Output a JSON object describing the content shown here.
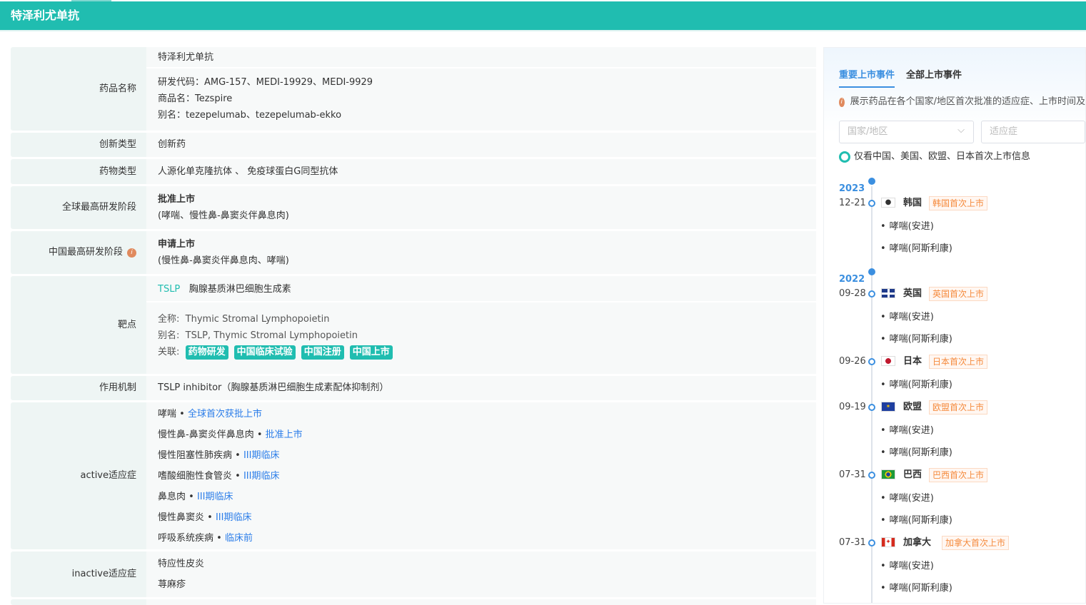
{
  "header": {
    "title": "特泽利尤单抗"
  },
  "rows": {
    "name": {
      "label": "药品名称",
      "value": "特泽利尤单抗",
      "code": "研发代码：AMG-157、MEDI-19929、MEDI-9929",
      "trade": "商品名：Tezspire",
      "alias": "别名：tezepelumab、tezepelumab-ekko"
    },
    "innov": {
      "label": "创新类型",
      "value": "创新药"
    },
    "type": {
      "label": "药物类型",
      "value": "人源化单克隆抗体 、 免疫球蛋白G同型抗体"
    },
    "global": {
      "label": "全球最高研发阶段",
      "stage": "批准上市",
      "detail": "(哮喘、慢性鼻-鼻窦炎伴鼻息肉)"
    },
    "china": {
      "label": "中国最高研发阶段",
      "stage": "申请上市",
      "detail": "(慢性鼻-鼻窦炎伴鼻息肉、哮喘)"
    },
    "target": {
      "label": "靶点",
      "code": "TSLP",
      "name": "胸腺基质淋巴细胞生成素",
      "full_label": "全称:",
      "full": "Thymic Stromal Lymphopoietin",
      "alias_label": "别名:",
      "alias": "TSLP, Thymic Stromal Lymphopoietin",
      "rel_label": "关联:",
      "tags": [
        "药物研发",
        "中国临床试验",
        "中国注册",
        "中国上市"
      ]
    },
    "mech": {
      "label": "作用机制",
      "value": "TSLP inhibitor（胸腺基质淋巴细胞生成素配体抑制剂）"
    },
    "active": {
      "label": "active适应症",
      "items": [
        {
          "name": "哮喘",
          "stage": "全球首次获批上市"
        },
        {
          "name": "慢性鼻-鼻窦炎伴鼻息肉",
          "stage": "批准上市"
        },
        {
          "name": "慢性阻塞性肺疾病",
          "stage": "III期临床"
        },
        {
          "name": "嗜酸细胞性食管炎",
          "stage": "III期临床"
        },
        {
          "name": "鼻息肉",
          "stage": "III期临床"
        },
        {
          "name": "慢性鼻窦炎",
          "stage": "III期临床"
        },
        {
          "name": "呼吸系统疾病",
          "stage": "临床前"
        }
      ]
    },
    "inactive": {
      "label": "inactive适应症",
      "items": [
        "特应性皮炎",
        "荨麻疹"
      ]
    }
  },
  "panel": {
    "tabs": [
      "重要上市事件",
      "全部上市事件"
    ],
    "note": "展示药品在各个国家/地区首次批准的适应症、上市时间及",
    "country_placeholder": "国家/地区",
    "indication_placeholder": "适应症",
    "only_label": "仅看中国、美国、欧盟、日本首次上市信息",
    "timeline": [
      {
        "year": "2023",
        "events": [
          {
            "date": "12-21",
            "flag": "kr",
            "country": "韩国",
            "badge": "韩国首次上市",
            "inds": [
              "哮喘(安进)",
              "哮喘(阿斯利康)"
            ]
          }
        ]
      },
      {
        "year": "2022",
        "events": [
          {
            "date": "09-28",
            "flag": "gb",
            "country": "英国",
            "badge": "英国首次上市",
            "inds": [
              "哮喘(安进)",
              "哮喘(阿斯利康)"
            ]
          },
          {
            "date": "09-26",
            "flag": "jp",
            "country": "日本",
            "badge": "日本首次上市",
            "inds": [
              "哮喘(阿斯利康)"
            ]
          },
          {
            "date": "09-19",
            "flag": "eu",
            "country": "欧盟",
            "badge": "欧盟首次上市",
            "inds": [
              "哮喘(安进)",
              "哮喘(阿斯利康)"
            ]
          },
          {
            "date": "07-31",
            "flag": "br",
            "country": "巴西",
            "badge": "巴西首次上市",
            "inds": [
              "哮喘(安进)",
              "哮喘(阿斯利康)"
            ]
          },
          {
            "date": "07-31",
            "flag": "ca",
            "country": "加拿大",
            "badge": "加拿大首次上市",
            "inds": [
              "哮喘(安进)",
              "哮喘(阿斯利康)"
            ]
          }
        ]
      }
    ]
  }
}
